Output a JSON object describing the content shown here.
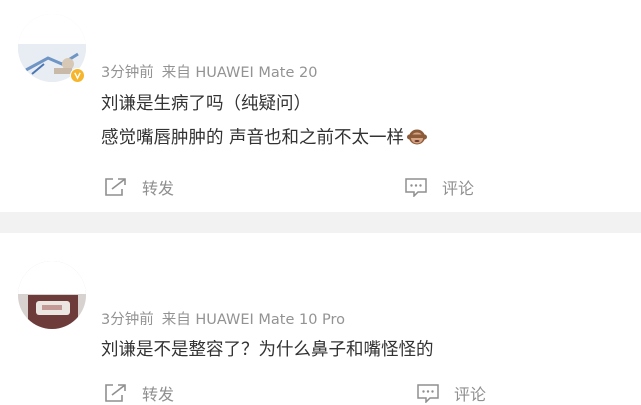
{
  "posts": [
    {
      "meta_time": "3分钟前",
      "meta_source": "来自 HUAWEI Mate 20",
      "lines": [
        "刘谦是生病了吗（纯疑问）",
        "感觉嘴唇肿肿的 声音也和之前不太一样"
      ],
      "emoji": "monkey-emoji",
      "actions": {
        "repost": "转发",
        "comment": "评论"
      },
      "verified": true
    },
    {
      "meta_time": "3分钟前",
      "meta_source": "来自 HUAWEI Mate 10 Pro",
      "lines": [
        "刘谦是不是整容了？为什么鼻子和嘴怪怪的"
      ],
      "actions": {
        "repost": "转发",
        "comment": "评论"
      },
      "verified": false
    }
  ],
  "colors": {
    "meta": "#939393",
    "text": "#333333",
    "action": "#8f8f8f",
    "separator": "#f2f2f2",
    "badge": "#f6b52b"
  }
}
